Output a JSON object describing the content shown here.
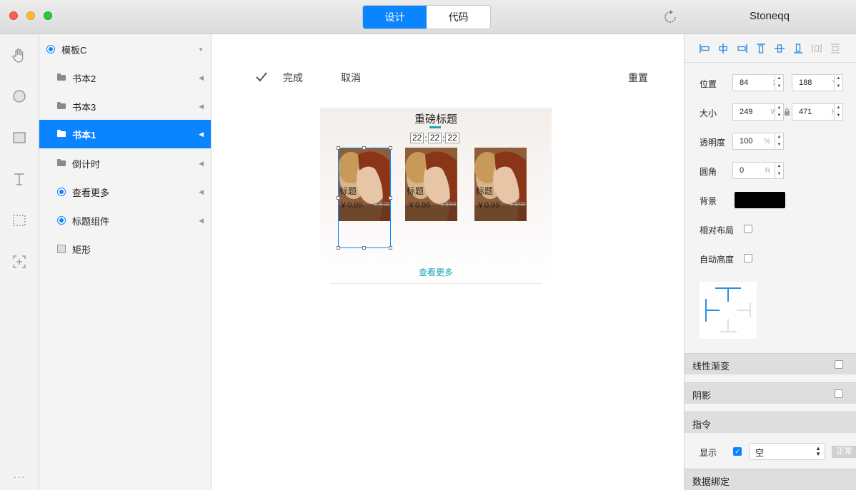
{
  "titlebar": {
    "tabs": [
      {
        "label": "设计",
        "active": true
      },
      {
        "label": "代码",
        "active": false
      }
    ],
    "user": "Stoneqq"
  },
  "toolbar": {
    "tools": [
      "hand-tool",
      "ellipse-tool",
      "rectangle-tool",
      "text-tool",
      "selection-tool",
      "add-component-tool"
    ],
    "more": "···"
  },
  "layers": {
    "items": [
      {
        "label": "模板C",
        "icon": "radio",
        "selected": false
      },
      {
        "label": "书本2",
        "icon": "folder",
        "selected": false
      },
      {
        "label": "书本3",
        "icon": "folder",
        "selected": false
      },
      {
        "label": "书本1",
        "icon": "folder",
        "selected": true
      },
      {
        "label": "倒计时",
        "icon": "folder",
        "selected": false
      },
      {
        "label": "查看更多",
        "icon": "radio",
        "selected": false
      },
      {
        "label": "标题组件",
        "icon": "radio",
        "selected": false
      },
      {
        "label": "矩形",
        "icon": "rectangle",
        "selected": false
      }
    ]
  },
  "canvas": {
    "done_label": "完成",
    "cancel_label": "取消",
    "reset_label": "重置",
    "card": {
      "title": "重磅标题",
      "timer": [
        "22",
        "22",
        "22"
      ],
      "timer_sep": ":",
      "see_more": "查看更多",
      "products": [
        {
          "title": "标题",
          "price": "￥0.99",
          "old_price": "￥3.00"
        },
        {
          "title": "标题",
          "price": "￥0.99",
          "old_price": "￥3.00"
        },
        {
          "title": "标题",
          "price": "￥0.99",
          "old_price": "￥3.00"
        }
      ]
    }
  },
  "inspector": {
    "position": {
      "label": "位置",
      "x": "84",
      "x_unit": "X",
      "y": "188",
      "y_unit": "Y"
    },
    "size": {
      "label": "大小",
      "w": "249",
      "w_unit": "W",
      "h": "471",
      "h_unit": "H"
    },
    "opacity": {
      "label": "透明度",
      "value": "100",
      "unit": "%"
    },
    "radius": {
      "label": "圆角",
      "value": "0",
      "unit": "R"
    },
    "background": {
      "label": "背景",
      "color": "#000000"
    },
    "relative_layout": {
      "label": "相对布局",
      "checked": false
    },
    "auto_height": {
      "label": "自动高度",
      "checked": false
    },
    "sections": {
      "linear_gradient": "线性渐变",
      "shadow": "阴影",
      "command": "指令",
      "data_binding": "数据绑定"
    },
    "display": {
      "label": "显示",
      "checked": true,
      "select_value": "空",
      "tag": "正常"
    }
  },
  "colors": {
    "accent": "#0a84ff",
    "teal": "#1aa5b8"
  }
}
